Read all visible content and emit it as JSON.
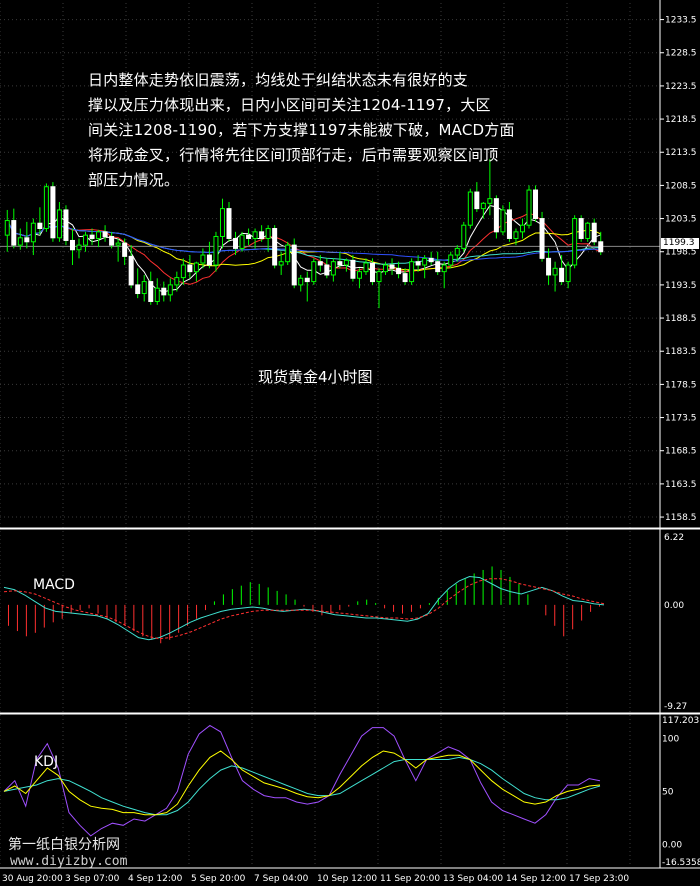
{
  "annotation": {
    "lines": [
      "日内整体走势依旧震荡，均线处于纠结状态未有很好的支",
      "撑以及压力体现出来，日内小区间可关注1204-1197，大区",
      "间关注1208-1190，若下方支撑1197未能被下破，MACD方面",
      "将形成金叉，行情将先往区间顶部行走，后市需要观察区间顶",
      "部压力情况。"
    ]
  },
  "chart_title": "现货黄金4小时图",
  "current_price": "1199.3",
  "watermark": {
    "text": "第一纸白银分析网",
    "url": "www.diyizby.com"
  },
  "colors": {
    "background": "#000000",
    "bull_candle": "#00ff00",
    "bear_candle": "#ffffff",
    "grid": "#3a3a3a",
    "ma_fast": "#ffffff",
    "ma_red": "#ff3030",
    "ma_yellow": "#ffff00",
    "ma_blue": "#3050ff",
    "ma_cyan": "#40e0d0",
    "macd_line": "#40e0d0",
    "macd_signal": "#ff3030",
    "kdj_k": "#ffff00",
    "kdj_d": "#40e0d0",
    "kdj_j": "#a050ff"
  },
  "chart_data": [
    {
      "type": "candlestick",
      "title": "现货黄金4小时图",
      "y_ticks": [
        "1233.5",
        "1228.5",
        "1223.5",
        "1218.5",
        "1213.5",
        "1208.5",
        "1203.5",
        "1198.5",
        "1193.5",
        "1188.5",
        "1183.5",
        "1178.5",
        "1173.5",
        "1168.5",
        "1163.5",
        "1158.5"
      ],
      "ylim": [
        1157,
        1236
      ],
      "x_ticks": [
        "30 Aug 20:00",
        "3 Sep 07:00",
        "4 Sep 12:00",
        "5 Sep 20:00",
        "7 Sep 04:00",
        "10 Sep 12:00",
        "11 Sep 20:00",
        "13 Sep 04:00",
        "14 Sep 12:00",
        "17 Sep 23:00"
      ],
      "ohlc": [
        [
          1201.0,
          1204.8,
          1198.5,
          1203.2
        ],
        [
          1203.2,
          1205.0,
          1199.0,
          1199.5
        ],
        [
          1199.5,
          1202.0,
          1198.8,
          1200.6
        ],
        [
          1200.6,
          1203.0,
          1199.0,
          1200.0
        ],
        [
          1200.0,
          1203.5,
          1198.0,
          1202.8
        ],
        [
          1202.8,
          1205.2,
          1201.0,
          1202.0
        ],
        [
          1202.0,
          1208.8,
          1201.5,
          1208.3
        ],
        [
          1208.3,
          1209.0,
          1200.0,
          1200.6
        ],
        [
          1200.6,
          1206.0,
          1200.0,
          1204.8
        ],
        [
          1204.8,
          1205.5,
          1199.5,
          1200.2
        ],
        [
          1200.2,
          1202.0,
          1196.5,
          1198.8
        ],
        [
          1198.8,
          1200.5,
          1197.5,
          1199.5
        ],
        [
          1199.5,
          1201.5,
          1198.5,
          1201.0
        ],
        [
          1201.0,
          1202.0,
          1199.5,
          1200.5
        ],
        [
          1200.5,
          1201.8,
          1199.2,
          1201.5
        ],
        [
          1201.5,
          1202.5,
          1200.0,
          1200.8
        ],
        [
          1200.8,
          1201.5,
          1199.0,
          1199.5
        ],
        [
          1199.5,
          1200.5,
          1197.0,
          1199.8
        ],
        [
          1199.8,
          1200.5,
          1196.5,
          1197.8
        ],
        [
          1197.8,
          1199.5,
          1193.0,
          1193.5
        ],
        [
          1193.5,
          1196.0,
          1191.5,
          1192.2
        ],
        [
          1192.2,
          1195.0,
          1191.0,
          1194.0
        ],
        [
          1194.0,
          1195.5,
          1190.5,
          1191.0
        ],
        [
          1191.0,
          1194.5,
          1190.5,
          1193.0
        ],
        [
          1193.0,
          1194.0,
          1191.0,
          1192.0
        ],
        [
          1192.0,
          1194.5,
          1191.0,
          1193.5
        ],
        [
          1193.5,
          1195.5,
          1192.5,
          1194.6
        ],
        [
          1194.6,
          1197.5,
          1193.5,
          1196.5
        ],
        [
          1196.5,
          1198.0,
          1194.5,
          1195.5
        ],
        [
          1195.5,
          1197.0,
          1194.0,
          1196.8
        ],
        [
          1196.8,
          1199.0,
          1196.0,
          1198.0
        ],
        [
          1198.0,
          1200.0,
          1196.0,
          1196.5
        ],
        [
          1196.5,
          1201.5,
          1195.5,
          1200.8
        ],
        [
          1200.8,
          1206.5,
          1199.0,
          1205.0
        ],
        [
          1205.0,
          1206.0,
          1200.0,
          1200.5
        ],
        [
          1200.5,
          1201.5,
          1198.0,
          1199.0
        ],
        [
          1199.0,
          1201.5,
          1198.5,
          1201.0
        ],
        [
          1201.0,
          1202.0,
          1199.5,
          1200.5
        ],
        [
          1200.5,
          1202.0,
          1199.0,
          1201.5
        ],
        [
          1201.5,
          1202.5,
          1200.0,
          1200.5
        ],
        [
          1200.5,
          1202.5,
          1198.5,
          1202.0
        ],
        [
          1202.0,
          1202.5,
          1196.0,
          1196.5
        ],
        [
          1196.5,
          1198.5,
          1195.0,
          1197.0
        ],
        [
          1197.0,
          1200.0,
          1196.5,
          1199.5
        ],
        [
          1199.5,
          1200.5,
          1193.0,
          1193.5
        ],
        [
          1193.5,
          1195.0,
          1192.5,
          1194.5
        ],
        [
          1194.5,
          1195.5,
          1191.0,
          1194.0
        ],
        [
          1194.0,
          1197.5,
          1193.5,
          1197.0
        ],
        [
          1197.0,
          1198.0,
          1195.5,
          1196.5
        ],
        [
          1196.5,
          1197.5,
          1194.5,
          1195.0
        ],
        [
          1195.0,
          1197.5,
          1194.0,
          1197.0
        ],
        [
          1197.0,
          1198.5,
          1196.0,
          1196.5
        ],
        [
          1196.5,
          1197.5,
          1195.5,
          1197.2
        ],
        [
          1197.2,
          1198.0,
          1194.0,
          1194.5
        ],
        [
          1194.5,
          1196.0,
          1193.0,
          1195.5
        ],
        [
          1195.5,
          1197.5,
          1195.0,
          1196.8
        ],
        [
          1196.8,
          1197.5,
          1193.5,
          1194.0
        ],
        [
          1194.0,
          1196.0,
          1190.0,
          1195.5
        ],
        [
          1195.5,
          1197.0,
          1195.0,
          1196.5
        ],
        [
          1196.5,
          1197.5,
          1195.0,
          1196.0
        ],
        [
          1196.0,
          1197.0,
          1194.5,
          1195.2
        ],
        [
          1195.2,
          1196.0,
          1193.5,
          1194.0
        ],
        [
          1194.0,
          1197.5,
          1193.5,
          1197.0
        ],
        [
          1197.0,
          1198.0,
          1195.5,
          1196.5
        ],
        [
          1196.5,
          1198.0,
          1194.5,
          1197.5
        ],
        [
          1197.5,
          1198.5,
          1196.5,
          1197.0
        ],
        [
          1197.0,
          1198.5,
          1195.0,
          1195.5
        ],
        [
          1195.5,
          1197.0,
          1193.0,
          1196.5
        ],
        [
          1196.5,
          1198.5,
          1196.0,
          1198.0
        ],
        [
          1198.0,
          1199.5,
          1197.0,
          1199.0
        ],
        [
          1199.0,
          1203.0,
          1198.5,
          1202.5
        ],
        [
          1202.5,
          1208.0,
          1202.0,
          1207.5
        ],
        [
          1207.5,
          1209.0,
          1204.5,
          1205.0
        ],
        [
          1205.0,
          1206.0,
          1203.5,
          1205.8
        ],
        [
          1205.8,
          1212.5,
          1204.0,
          1206.5
        ],
        [
          1206.5,
          1207.0,
          1200.5,
          1201.5
        ],
        [
          1201.5,
          1205.5,
          1201.0,
          1204.8
        ],
        [
          1204.8,
          1206.0,
          1200.0,
          1200.5
        ],
        [
          1200.5,
          1202.0,
          1199.5,
          1201.5
        ],
        [
          1201.5,
          1203.5,
          1200.5,
          1202.5
        ],
        [
          1202.5,
          1208.5,
          1202.0,
          1207.8
        ],
        [
          1207.8,
          1208.5,
          1203.0,
          1203.5
        ],
        [
          1203.5,
          1204.5,
          1197.0,
          1197.5
        ],
        [
          1197.5,
          1199.0,
          1193.5,
          1195.0
        ],
        [
          1195.0,
          1197.0,
          1192.5,
          1196.0
        ],
        [
          1196.0,
          1198.0,
          1193.5,
          1194.0
        ],
        [
          1194.0,
          1197.0,
          1193.0,
          1196.5
        ],
        [
          1196.5,
          1204.0,
          1196.0,
          1203.5
        ],
        [
          1203.5,
          1204.0,
          1200.0,
          1200.5
        ],
        [
          1200.5,
          1203.0,
          1200.0,
          1202.8
        ],
        [
          1202.8,
          1203.5,
          1199.5,
          1200.0
        ],
        [
          1200.0,
          1201.5,
          1198.0,
          1198.5
        ]
      ]
    },
    {
      "type": "line",
      "title": "MACD",
      "y_ticks": [
        "6.22",
        "0.00",
        "-9.27"
      ],
      "ylim": [
        -9.27,
        6.22
      ],
      "histogram": [
        -1.2,
        -1.5,
        -1.8,
        -1.6,
        -1.3,
        -1.0,
        -0.8,
        -0.5,
        -0.3,
        -0.2,
        -0.5,
        -0.8,
        -1.0,
        -1.2,
        -1.5,
        -1.8,
        -2.0,
        -2.2,
        -2.0,
        -1.6,
        -1.2,
        -0.8,
        -0.3,
        0.2,
        0.6,
        0.9,
        1.1,
        1.3,
        1.2,
        1.0,
        0.8,
        0.6,
        0.3,
        -0.1,
        -0.4,
        -0.6,
        -0.5,
        -0.3,
        -0.1,
        0.2,
        0.3,
        0.1,
        -0.2,
        -0.4,
        -0.5,
        -0.4,
        -0.2,
        0.1,
        0.4,
        0.8,
        1.2,
        1.5,
        1.8,
        2.0,
        2.2,
        2.0,
        1.6,
        1.2,
        0.6,
        0.0,
        -0.6,
        -1.2,
        -1.8,
        -1.4,
        -0.9,
        -0.4,
        -0.1
      ],
      "macd": [
        1.6,
        1.4,
        0.9,
        0.3,
        -0.3,
        -0.6,
        -0.7,
        -0.8,
        -0.9,
        -1.0,
        -1.3,
        -1.8,
        -2.4,
        -3.0,
        -3.2,
        -3.0,
        -2.6,
        -2.1,
        -1.6,
        -1.2,
        -0.9,
        -0.6,
        -0.4,
        -0.3,
        -0.2,
        -0.3,
        -0.5,
        -0.6,
        -0.5,
        -0.4,
        -0.5,
        -0.7,
        -0.9,
        -1.0,
        -1.1,
        -1.2,
        -1.2,
        -1.3,
        -1.4,
        -1.5,
        -1.3,
        -0.8,
        0.5,
        1.5,
        2.2,
        2.6,
        2.5,
        2.0,
        1.5,
        1.2,
        1.0,
        1.3,
        1.6,
        1.3,
        0.8,
        0.4,
        0.3,
        0.1,
        0.0
      ],
      "signal": [
        1.2,
        1.3,
        1.2,
        1.0,
        0.6,
        0.2,
        -0.2,
        -0.5,
        -0.7,
        -0.9,
        -1.1,
        -1.5,
        -2.0,
        -2.5,
        -2.9,
        -3.1,
        -3.0,
        -2.8,
        -2.5,
        -2.1,
        -1.7,
        -1.3,
        -1.0,
        -0.8,
        -0.6,
        -0.5,
        -0.5,
        -0.5,
        -0.5,
        -0.5,
        -0.5,
        -0.6,
        -0.7,
        -0.8,
        -0.9,
        -1.0,
        -1.1,
        -1.2,
        -1.2,
        -1.3,
        -1.2,
        -0.9,
        -0.3,
        0.5,
        1.2,
        1.8,
        2.2,
        2.4,
        2.4,
        2.2,
        1.9,
        1.7,
        1.5,
        1.3,
        1.0,
        0.8,
        0.5,
        0.3,
        0.1
      ]
    },
    {
      "type": "line",
      "title": "KDJ",
      "y_ticks": [
        "117.2031",
        "100",
        "50",
        "0.00",
        "-16.5358"
      ],
      "ylim": [
        -16.5358,
        117.2031
      ],
      "k": [
        50,
        55,
        48,
        60,
        72,
        65,
        50,
        42,
        36,
        34,
        33,
        30,
        30,
        28,
        28,
        30,
        38,
        55,
        70,
        82,
        88,
        80,
        70,
        64,
        58,
        55,
        52,
        48,
        45,
        44,
        46,
        54,
        64,
        74,
        82,
        88,
        86,
        80,
        72,
        80,
        82,
        84,
        84,
        80,
        70,
        60,
        52,
        46,
        40,
        38,
        40,
        46,
        50,
        52,
        55,
        56
      ],
      "d": [
        50,
        52,
        54,
        56,
        60,
        62,
        60,
        55,
        50,
        44,
        40,
        36,
        33,
        30,
        28,
        28,
        32,
        40,
        52,
        62,
        70,
        74,
        72,
        68,
        64,
        60,
        56,
        52,
        48,
        46,
        46,
        48,
        54,
        60,
        66,
        72,
        78,
        80,
        80,
        80,
        80,
        80,
        82,
        80,
        76,
        70,
        62,
        55,
        48,
        44,
        42,
        42,
        44,
        48,
        52,
        55
      ],
      "j": [
        50,
        60,
        36,
        80,
        95,
        72,
        30,
        18,
        8,
        15,
        20,
        18,
        24,
        22,
        28,
        34,
        50,
        85,
        104,
        112,
        106,
        82,
        60,
        52,
        46,
        44,
        44,
        40,
        38,
        40,
        46,
        66,
        84,
        102,
        110,
        110,
        102,
        80,
        60,
        80,
        86,
        92,
        88,
        80,
        58,
        40,
        32,
        28,
        24,
        20,
        28,
        44,
        56,
        56,
        62,
        60
      ]
    }
  ]
}
